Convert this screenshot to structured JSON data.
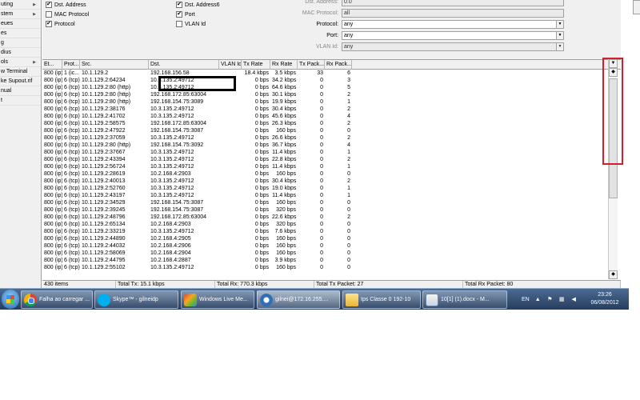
{
  "sidebar": {
    "items": [
      {
        "label": "uting",
        "arrow": true
      },
      {
        "label": "stem",
        "arrow": true
      },
      {
        "label": "eues",
        "arrow": false
      },
      {
        "label": "es",
        "arrow": false
      },
      {
        "label": "g",
        "arrow": false
      },
      {
        "label": "dius",
        "arrow": false
      },
      {
        "label": "ols",
        "arrow": true
      },
      {
        "label": "w Terminal",
        "arrow": false
      },
      {
        "label": "ke Supout.rif",
        "arrow": false
      },
      {
        "label": "nual",
        "arrow": false
      },
      {
        "label": "t",
        "arrow": false
      }
    ],
    "arrow_glyph": "▶"
  },
  "filters": {
    "checkboxes_left": [
      {
        "label": "Dst. Address",
        "checked": true
      },
      {
        "label": "MAC Protocol",
        "checked": false
      },
      {
        "label": "Protocol",
        "checked": true
      }
    ],
    "checkboxes_right": [
      {
        "label": "Dst. Address6",
        "checked": true
      },
      {
        "label": "Port",
        "checked": true
      },
      {
        "label": "VLAN Id",
        "checked": false
      }
    ],
    "check_glyph": "✔",
    "fields": [
      {
        "label": "Dst. Address:",
        "value": "0.0",
        "disabled": true,
        "dropdown": false
      },
      {
        "label": "MAC Protocol:",
        "value": "all",
        "disabled": true,
        "dropdown": false
      },
      {
        "label": "Protocol:",
        "value": "any",
        "disabled": false,
        "dropdown": true
      },
      {
        "label": "Port:",
        "value": "any",
        "disabled": false,
        "dropdown": true
      },
      {
        "label": "VLAN Id:",
        "value": "any",
        "disabled": true,
        "dropdown": true
      }
    ],
    "dropdown_glyph": "▼"
  },
  "table": {
    "headers": [
      "Et...",
      "Prot...",
      "Src.",
      "Dst.",
      "VLAN Id",
      "Tx Rate",
      "Rx Rate",
      "Tx Pack...",
      "Rx Pack..."
    ],
    "sort_glyph": "/",
    "rows": [
      [
        "800 (ip)",
        "1 (ic...",
        "10.1.129.2",
        "192.168.156.58",
        "",
        "18.4 kbps",
        "3.5 kbps",
        "33",
        "6"
      ],
      [
        "800 (ip)",
        "6 (tcp)",
        "10.1.129.2:64234",
        "10.3.135.2:49712",
        "",
        "0 bps",
        "34.2 kbps",
        "0",
        "3"
      ],
      [
        "800 (ip)",
        "6 (tcp)",
        "10.1.129.2:80 (http)",
        "10.3.135.2:49712",
        "",
        "0 bps",
        "64.6 kbps",
        "0",
        "5"
      ],
      [
        "800 (ip)",
        "6 (tcp)",
        "10.1.129.2:80 (http)",
        "192.168.172.85:63004",
        "",
        "0 bps",
        "30.1 kbps",
        "0",
        "2"
      ],
      [
        "800 (ip)",
        "6 (tcp)",
        "10.1.129.2:80 (http)",
        "192.168.154.75:3089",
        "",
        "0 bps",
        "19.9 kbps",
        "0",
        "1"
      ],
      [
        "800 (ip)",
        "6 (tcp)",
        "10.1.129.2:38176",
        "10.3.135.2:49712",
        "",
        "0 bps",
        "30.4 kbps",
        "0",
        "2"
      ],
      [
        "800 (ip)",
        "6 (tcp)",
        "10.1.129.2:41702",
        "10.3.135.2:49712",
        "",
        "0 bps",
        "45.6 kbps",
        "0",
        "4"
      ],
      [
        "800 (ip)",
        "6 (tcp)",
        "10.1.129.2:58575",
        "192.168.172.85:63004",
        "",
        "0 bps",
        "26.3 kbps",
        "0",
        "2"
      ],
      [
        "800 (ip)",
        "6 (tcp)",
        "10.1.129.2:47922",
        "192.168.154.75:3087",
        "",
        "0 bps",
        "160 bps",
        "0",
        "0"
      ],
      [
        "800 (ip)",
        "6 (tcp)",
        "10.1.129.2:37059",
        "10.3.135.2:49712",
        "",
        "0 bps",
        "26.6 kbps",
        "0",
        "2"
      ],
      [
        "800 (ip)",
        "6 (tcp)",
        "10.1.129.2:80 (http)",
        "192.168.154.75:3092",
        "",
        "0 bps",
        "36.7 kbps",
        "0",
        "4"
      ],
      [
        "800 (ip)",
        "6 (tcp)",
        "10.1.129.2:37667",
        "10.3.135.2:49712",
        "",
        "0 bps",
        "11.4 kbps",
        "0",
        "1"
      ],
      [
        "800 (ip)",
        "6 (tcp)",
        "10.1.129.2:43394",
        "10.3.135.2:49712",
        "",
        "0 bps",
        "22.8 kbps",
        "0",
        "2"
      ],
      [
        "800 (ip)",
        "6 (tcp)",
        "10.1.129.2:56724",
        "10.3.135.2:49712",
        "",
        "0 bps",
        "11.4 kbps",
        "0",
        "1"
      ],
      [
        "800 (ip)",
        "6 (tcp)",
        "10.1.129.2:28619",
        "10.2.168.4:2903",
        "",
        "0 bps",
        "160 bps",
        "0",
        "0"
      ],
      [
        "800 (ip)",
        "6 (tcp)",
        "10.1.129.2:40013",
        "10.3.135.2:49712",
        "",
        "0 bps",
        "30.4 kbps",
        "0",
        "2"
      ],
      [
        "800 (ip)",
        "6 (tcp)",
        "10.1.129.2:52760",
        "10.3.135.2:49712",
        "",
        "0 bps",
        "19.0 kbps",
        "0",
        "1"
      ],
      [
        "800 (ip)",
        "6 (tcp)",
        "10.1.129.2:43197",
        "10.3.135.2:49712",
        "",
        "0 bps",
        "11.4 kbps",
        "0",
        "1"
      ],
      [
        "800 (ip)",
        "6 (tcp)",
        "10.1.129.2:34529",
        "192.168.154.75:3087",
        "",
        "0 bps",
        "160 bps",
        "0",
        "0"
      ],
      [
        "800 (ip)",
        "6 (tcp)",
        "10.1.129.2:39245",
        "192.168.154.75:3087",
        "",
        "0 bps",
        "320 bps",
        "0",
        "0"
      ],
      [
        "800 (ip)",
        "6 (tcp)",
        "10.1.129.2:48796",
        "192.168.172.85:63004",
        "",
        "0 bps",
        "22.6 kbps",
        "0",
        "2"
      ],
      [
        "800 (ip)",
        "6 (tcp)",
        "10.1.129.2:65134",
        "10.2.168.4:2903",
        "",
        "0 bps",
        "320 bps",
        "0",
        "0"
      ],
      [
        "800 (ip)",
        "6 (tcp)",
        "10.1.129.2:33219",
        "10.3.135.2:49712",
        "",
        "0 bps",
        "7.6 kbps",
        "0",
        "0"
      ],
      [
        "800 (ip)",
        "6 (tcp)",
        "10.1.129.2:44890",
        "10.2.168.4:2905",
        "",
        "0 bps",
        "160 bps",
        "0",
        "0"
      ],
      [
        "800 (ip)",
        "6 (tcp)",
        "10.1.129.2:44032",
        "10.2.168.4:2906",
        "",
        "0 bps",
        "160 bps",
        "0",
        "0"
      ],
      [
        "800 (ip)",
        "6 (tcp)",
        "10.1.129.2:58069",
        "10.2.168.4:2904",
        "",
        "0 bps",
        "160 bps",
        "0",
        "0"
      ],
      [
        "800 (ip)",
        "6 (tcp)",
        "10.1.129.2:44795",
        "10.2.168.4:2887",
        "",
        "0 bps",
        "3.9 kbps",
        "0",
        "0"
      ],
      [
        "800 (ip)",
        "6 (tcp)",
        "10.1.129.2:55102",
        "10.3.135.2:49712",
        "",
        "0 bps",
        "160 bps",
        "0",
        "0"
      ]
    ]
  },
  "scrollbar": {
    "up_glyph": "▼",
    "down_glyph": "◆",
    "bottom_glyph": "◆"
  },
  "status_bar": {
    "items": "430 items",
    "total_tx": "Total Tx: 15.1 kbps",
    "total_rx": "Total Rx: 770.3 kbps",
    "total_tx_packet": "Total Tx Packet: 27",
    "total_rx_packet": "Total Rx Packet: 80"
  },
  "taskbar": {
    "tasks": [
      {
        "label": "Falha ao carregar ...",
        "icon": "chrome-icon",
        "active": false
      },
      {
        "label": "Skype™ - gilneidp",
        "icon": "skype-icon",
        "active": false
      },
      {
        "label": "Windows Live Me...",
        "icon": "windows-live-icon",
        "active": false
      },
      {
        "label": "gilnei@172.16.255....",
        "icon": "winbox-icon",
        "active": true
      },
      {
        "label": "Ips Classe 0 192-10",
        "icon": "folder-icon",
        "active": false
      },
      {
        "label": "10[1] (1).docx - M...",
        "icon": "word-icon",
        "active": false
      }
    ],
    "language": "EN",
    "time": "23:26",
    "date": "06/08/2012"
  },
  "colors": {
    "highlight_box": "#d31f2b",
    "marker_box": "#000000"
  }
}
